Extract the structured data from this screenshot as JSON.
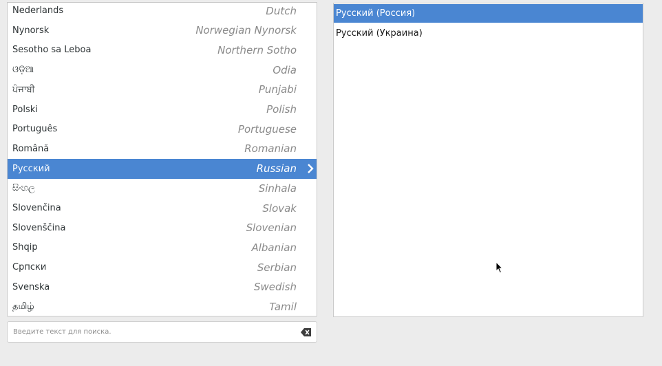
{
  "language_list": {
    "items": [
      {
        "native": "Nederlands",
        "english": "Dutch"
      },
      {
        "native": "Nynorsk",
        "english": "Norwegian Nynorsk"
      },
      {
        "native": "Sesotho sa Leboa",
        "english": "Northern Sotho"
      },
      {
        "native": "ଓଡ଼ିଆ",
        "english": "Odia"
      },
      {
        "native": "ਪੰਜਾਬੀ",
        "english": "Punjabi"
      },
      {
        "native": "Polski",
        "english": "Polish"
      },
      {
        "native": "Português",
        "english": "Portuguese"
      },
      {
        "native": "Română",
        "english": "Romanian"
      },
      {
        "native": "Русский",
        "english": "Russian",
        "selected": true
      },
      {
        "native": "සිංහල",
        "english": "Sinhala"
      },
      {
        "native": "Slovenčina",
        "english": "Slovak"
      },
      {
        "native": "Slovenščina",
        "english": "Slovenian"
      },
      {
        "native": "Shqip",
        "english": "Albanian"
      },
      {
        "native": "Српски",
        "english": "Serbian"
      },
      {
        "native": "Svenska",
        "english": "Swedish"
      },
      {
        "native": "தமிழ்",
        "english": "Tamil"
      }
    ],
    "selected_chevron_icon": "chevron-right-icon"
  },
  "search": {
    "placeholder": "Введите текст для поиска.",
    "value": "",
    "clear_icon": "backspace-clear-icon"
  },
  "locale_list": {
    "items": [
      {
        "label": "Русский (Россия)",
        "selected": true
      },
      {
        "label": "Русский (Украина)",
        "selected": false
      }
    ]
  },
  "colors": {
    "selection": "#4a86d2",
    "background": "#ececec",
    "panel": "#ffffff",
    "english_text": "#8a8a8a"
  }
}
